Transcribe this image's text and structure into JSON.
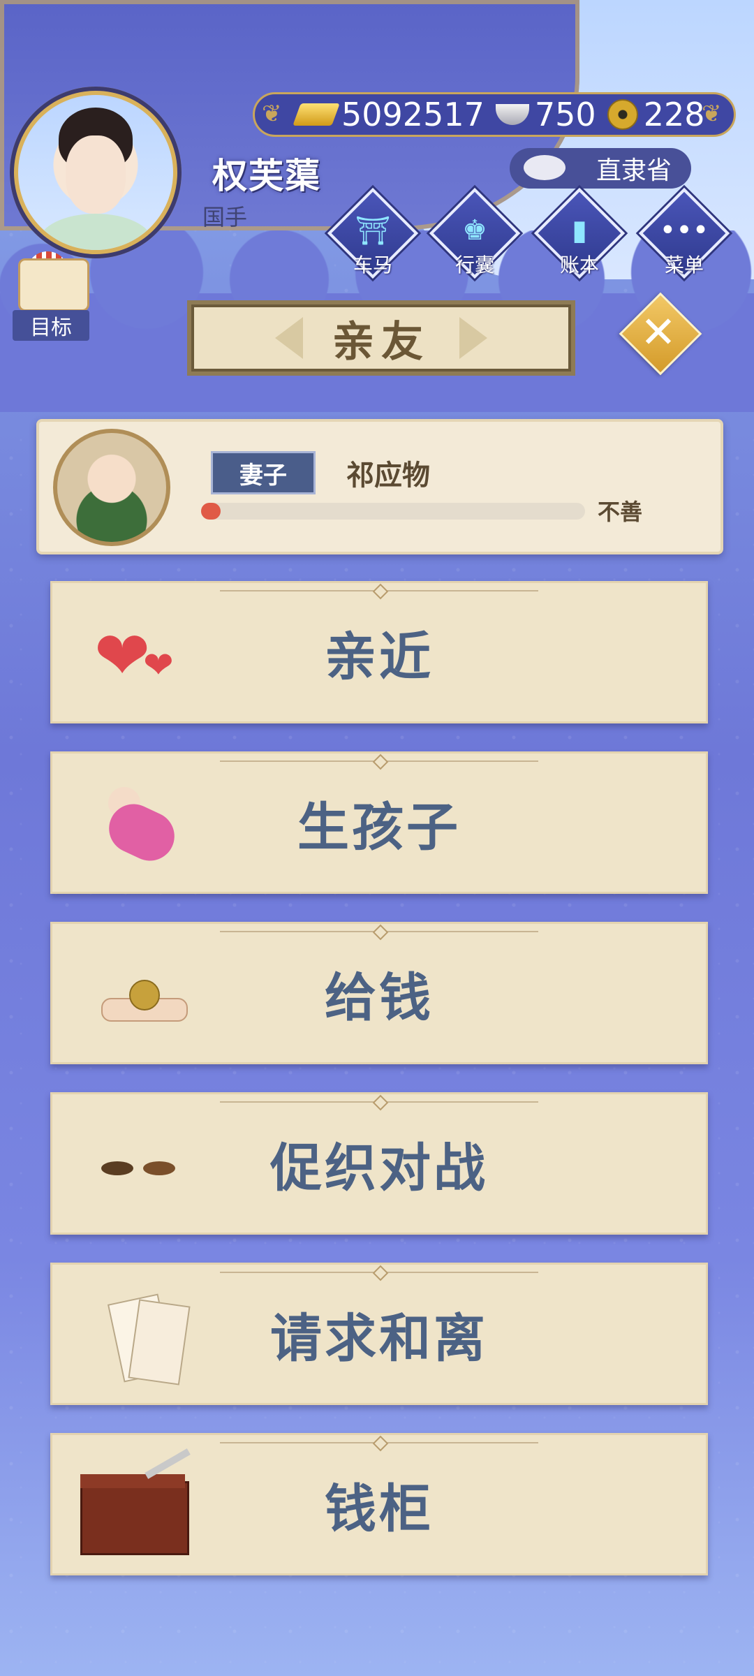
{
  "player": {
    "name": "权芙蕖",
    "title": "国手"
  },
  "currency": {
    "gold": "5092517",
    "silver": "750",
    "coins": "228"
  },
  "location": "直隶省",
  "top_menu": [
    {
      "label": "车马",
      "icon": "carriage-icon"
    },
    {
      "label": "行囊",
      "icon": "bag-icon"
    },
    {
      "label": "账本",
      "icon": "ledger-icon"
    },
    {
      "label": "菜单",
      "icon": "menu-dots-icon"
    }
  ],
  "goal_label": "目标",
  "panel_title": "亲友",
  "spouse": {
    "role": "妻子",
    "name": "祁应物",
    "relation_status": "不善",
    "relation_level": 0.05
  },
  "actions": [
    {
      "label": "亲近",
      "icon": "hearts-icon"
    },
    {
      "label": "生孩子",
      "icon": "baby-icon"
    },
    {
      "label": "给钱",
      "icon": "money-hand-icon"
    },
    {
      "label": "促织对战",
      "icon": "cricket-icon"
    },
    {
      "label": "请求和离",
      "icon": "divorce-letter-icon"
    },
    {
      "label": "钱柜",
      "icon": "money-chest-icon"
    }
  ],
  "colors": {
    "accent_gold": "#d9b15a",
    "action_text": "#4c6284",
    "bar_fill": "#e05a46"
  }
}
